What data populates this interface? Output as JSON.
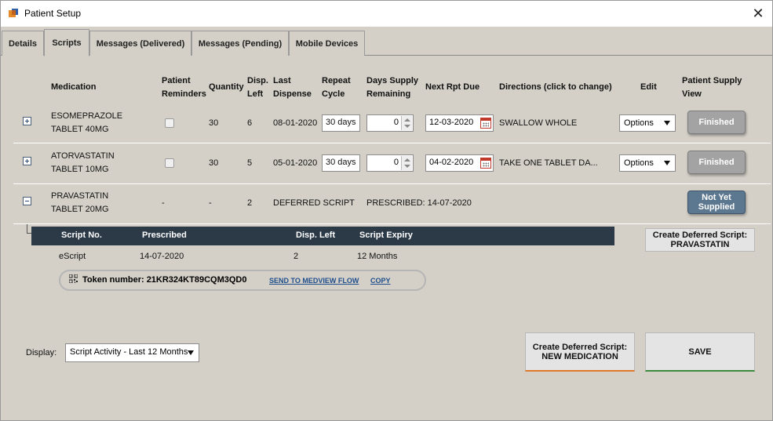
{
  "window": {
    "title": "Patient Setup"
  },
  "tabs": [
    {
      "label": "Details"
    },
    {
      "label": "Scripts"
    },
    {
      "label": "Messages (Delivered)"
    },
    {
      "label": "Messages (Pending)"
    },
    {
      "label": "Mobile Devices"
    }
  ],
  "active_tab": "Scripts",
  "columns": {
    "medication": "Medication",
    "patient_reminders_1": "Patient",
    "patient_reminders_2": "Reminders",
    "quantity": "Quantity",
    "disp_left_1": "Disp.",
    "disp_left_2": "Left",
    "last_dispense_1": "Last",
    "last_dispense_2": "Dispense",
    "repeat_cycle_1": "Repeat",
    "repeat_cycle_2": "Cycle",
    "days_supply_1": "Days Supply",
    "days_supply_2": "Remaining",
    "next_rpt_due": "Next Rpt Due",
    "directions": "Directions (click to change)",
    "edit": "Edit",
    "patient_supply_1": "Patient Supply",
    "patient_supply_2": "View"
  },
  "rows": [
    {
      "med_line1": "ESOMEPRAZOLE",
      "med_line2": "TABLET 40MG",
      "quantity": "30",
      "disp_left": "6",
      "last_dispense": "08-01-2020",
      "repeat_cycle": "30 days",
      "days_supply": "0",
      "next_rpt_due": "12-03-2020",
      "directions": "SWALLOW WHOLE",
      "edit": "Options",
      "supply": "Finished"
    },
    {
      "med_line1": "ATORVASTATIN",
      "med_line2": "TABLET 10MG",
      "quantity": "30",
      "disp_left": "5",
      "last_dispense": "05-01-2020",
      "repeat_cycle": "30 days",
      "days_supply": "0",
      "next_rpt_due": "04-02-2020",
      "directions": "TAKE ONE TABLET DA...",
      "edit": "Options",
      "supply": "Finished"
    },
    {
      "med_line1": "PRAVASTATIN",
      "med_line2": "TABLET 20MG",
      "quantity": "-",
      "patient_reminders": "-",
      "disp_left": "2",
      "last_dispense": "DEFERRED SCRIPT",
      "prescribed": "PRESCRIBED: 14-07-2020",
      "supply_line1": "Not Yet",
      "supply_line2": "Supplied"
    }
  ],
  "subgrid": {
    "headers": {
      "script_no": "Script No.",
      "prescribed": "Prescribed",
      "disp_left": "Disp. Left",
      "expiry": "Script Expiry"
    },
    "row": {
      "script_no": "eScript",
      "prescribed": "14-07-2020",
      "disp_left": "2",
      "expiry": "12 Months"
    },
    "token": "Token number: 21KR324KT89CQM3QD0",
    "send_link": "SEND TO MEDVIEW FLOW",
    "copy_link": "COPY"
  },
  "create_deferred_pravastatin": {
    "line1": "Create Deferred Script:",
    "line2": "PRAVASTATIN"
  },
  "display": {
    "label": "Display:",
    "value": "Script Activity - Last 12 Months"
  },
  "create_deferred_new": {
    "line1": "Create Deferred Script:",
    "line2": "NEW MEDICATION"
  },
  "save_label": "SAVE"
}
